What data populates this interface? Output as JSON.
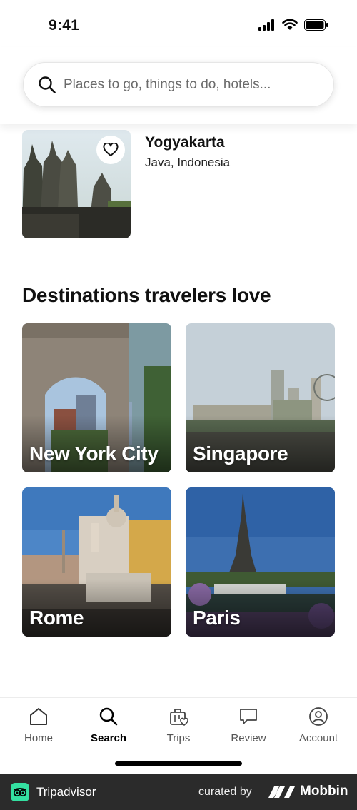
{
  "status_bar": {
    "time": "9:41"
  },
  "search": {
    "placeholder": "Places to go, things to do, hotels..."
  },
  "saved_item": {
    "title": "Yogyakarta",
    "subtitle": "Java, Indonesia"
  },
  "destinations": {
    "title": "Destinations travelers love",
    "items": [
      {
        "label": "New York City"
      },
      {
        "label": "Singapore"
      },
      {
        "label": "Rome"
      },
      {
        "label": "Paris"
      }
    ]
  },
  "nav": {
    "items": [
      {
        "label": "Home",
        "icon": "home-icon"
      },
      {
        "label": "Search",
        "icon": "search-icon",
        "active": true
      },
      {
        "label": "Trips",
        "icon": "suitcase-heart-icon"
      },
      {
        "label": "Review",
        "icon": "speech-bubble-icon"
      },
      {
        "label": "Account",
        "icon": "account-icon"
      }
    ]
  },
  "footer": {
    "brand": "Tripadvisor",
    "curated_by": "curated by",
    "mobbin": "Mobbin"
  },
  "colors": {
    "accent": "#34e0a1",
    "footer_bg": "#2b2b2b",
    "text": "#111111"
  }
}
